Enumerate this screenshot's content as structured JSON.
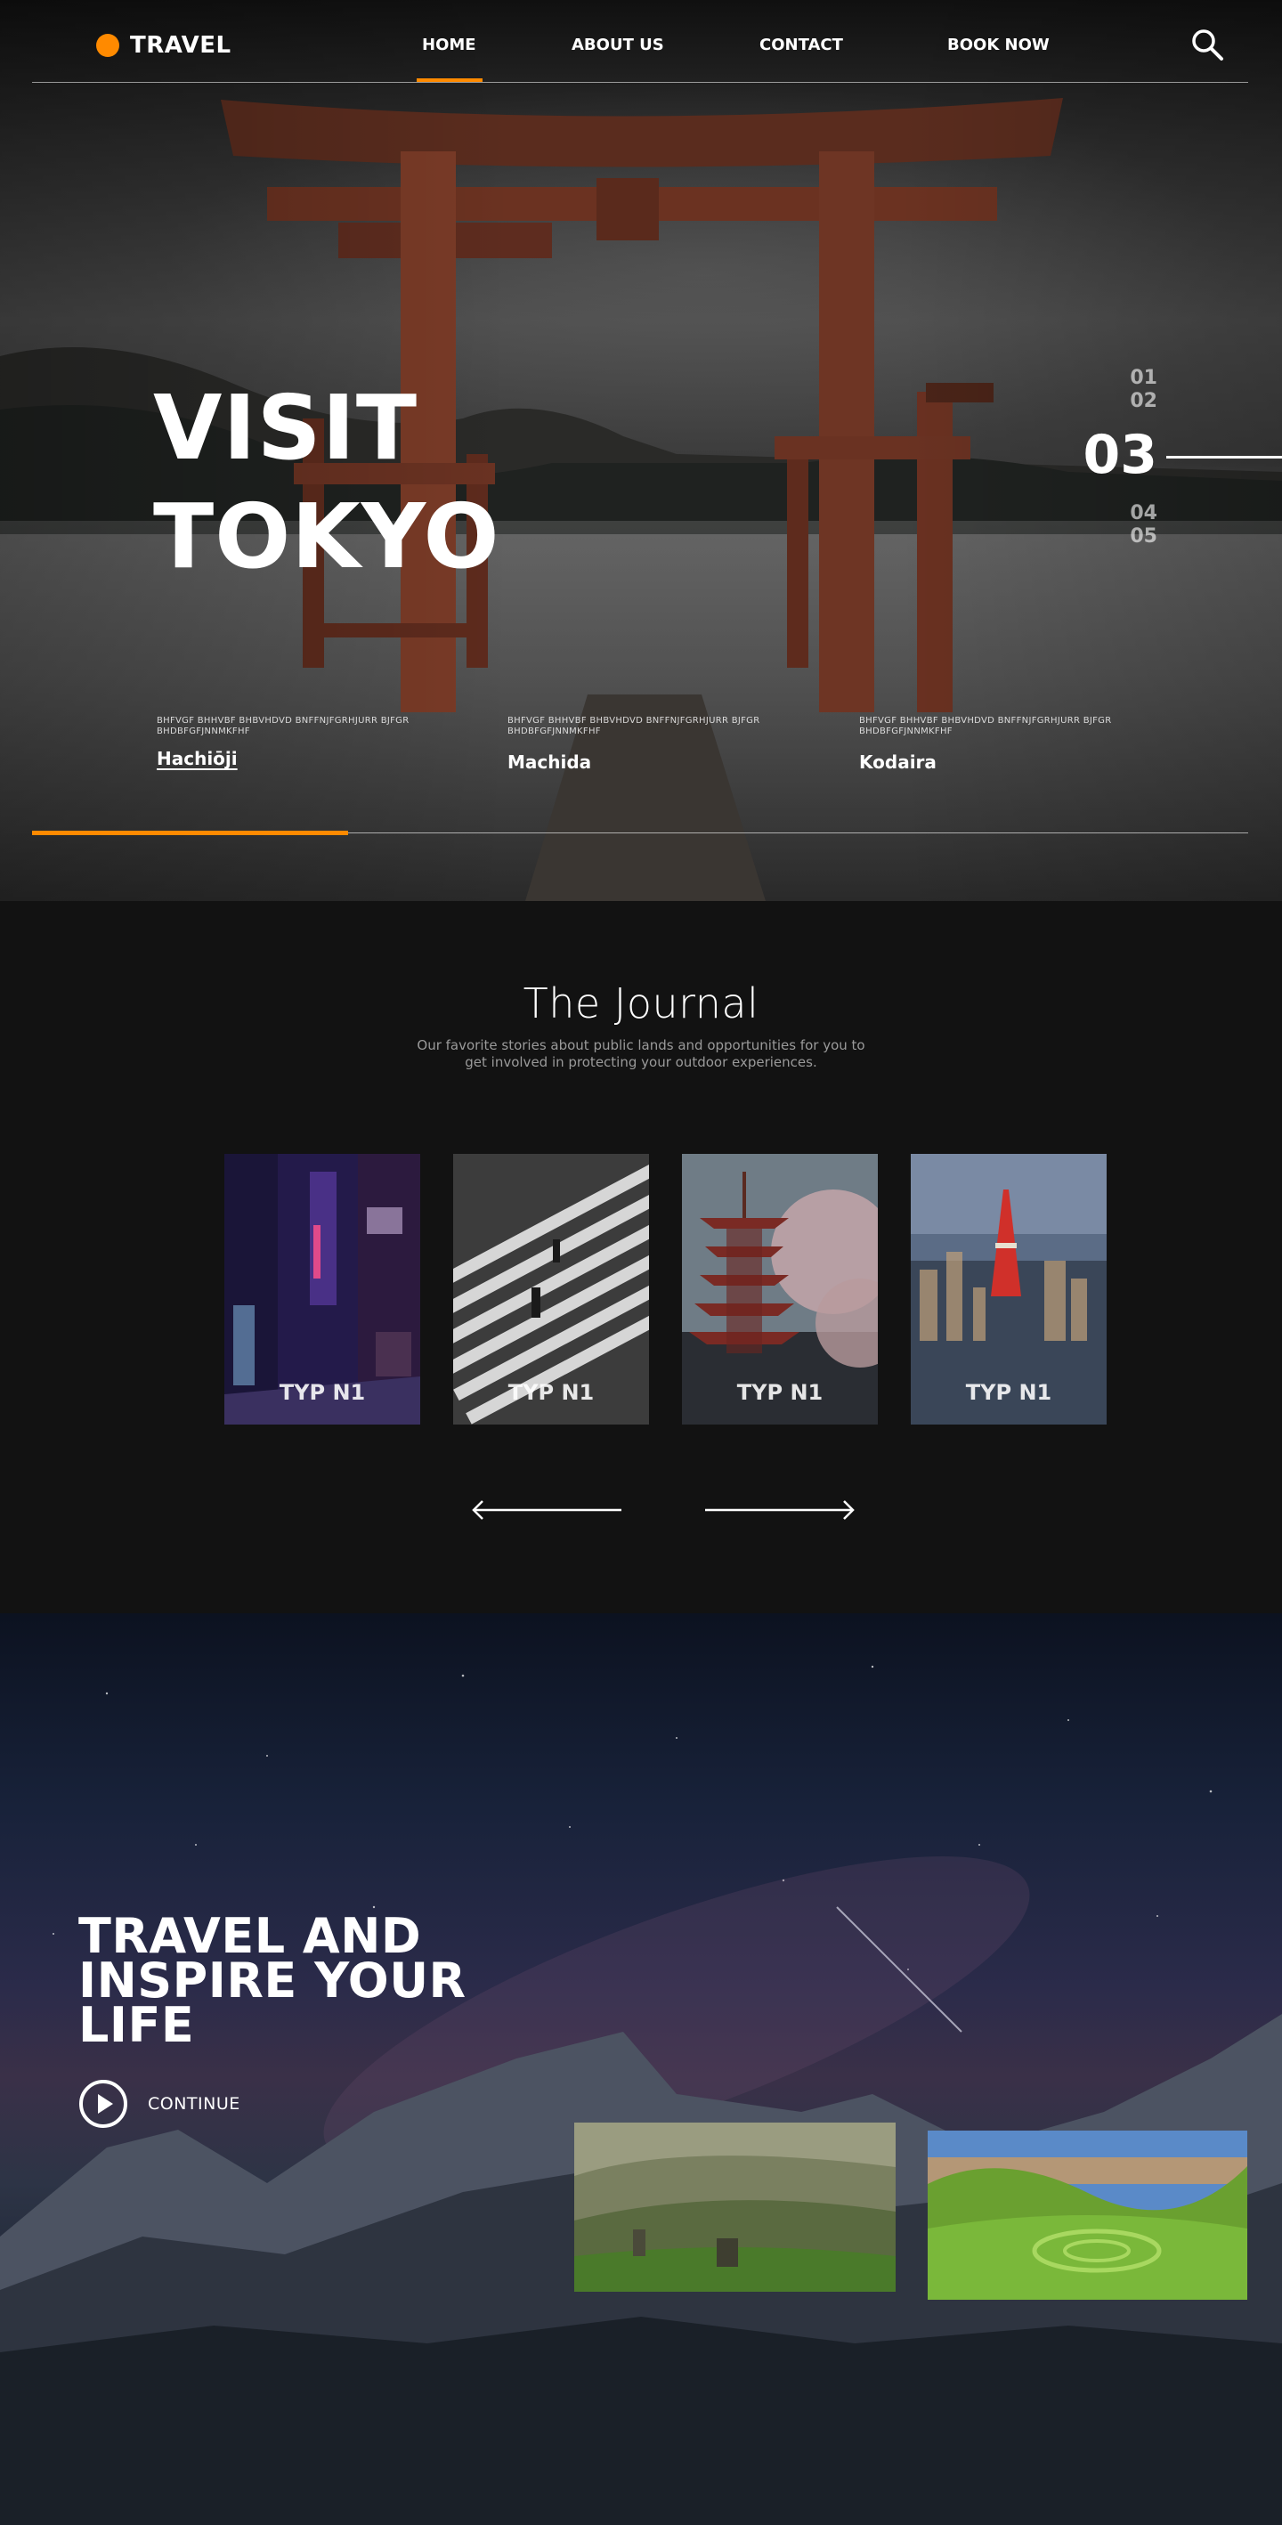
{
  "brand": {
    "logo_text": "TRAVEL",
    "accent": "#ff8a00"
  },
  "nav": {
    "links": [
      {
        "label": "HOME",
        "active": true
      },
      {
        "label": "ABOUT US",
        "active": false
      },
      {
        "label": "CONTACT",
        "active": false
      },
      {
        "label": "BOOK NOW",
        "active": false
      }
    ],
    "search_icon": "search-icon"
  },
  "hero": {
    "title_line1": "VISIT",
    "title_line2": "TOKYO",
    "slides": [
      "01",
      "02",
      "03",
      "04",
      "05"
    ],
    "active_slide": "03",
    "places": [
      {
        "desc": "BHFVGF BHHVBF BHBVHDVD BNFFNJFGRHJURR BJFGR BHDBFGFJNNMKFHF",
        "name": "Hachiōji",
        "current": true
      },
      {
        "desc": "BHFVGF BHHVBF BHBVHDVD BNFFNJFGRHJURR BJFGR BHDBFGFJNNMKFHF",
        "name": "Machida",
        "current": false
      },
      {
        "desc": "BHFVGF BHHVBF BHBVHDVD BNFFNJFGRHJURR BJFGR BHDBFGFJNNMKFHF",
        "name": "Kodaira",
        "current": false
      }
    ],
    "progress": 0.26
  },
  "journal": {
    "title": "The Journal",
    "subtitle": "Our favorite stories about public lands and opportunities for you to get involved in protecting your outdoor experiences.",
    "cards": [
      {
        "label": "TYP N1"
      },
      {
        "label": "TYP N1"
      },
      {
        "label": "TYP N1"
      },
      {
        "label": "TYP N1"
      }
    ],
    "prev_icon": "arrow-left-icon",
    "next_icon": "arrow-right-icon"
  },
  "inspire": {
    "title_line1": "TRAVEL AND",
    "title_line2": "INSPIRE YOUR",
    "title_line3": "LIFE",
    "continue_label": "CONTINUE",
    "play_icon": "play-icon"
  }
}
